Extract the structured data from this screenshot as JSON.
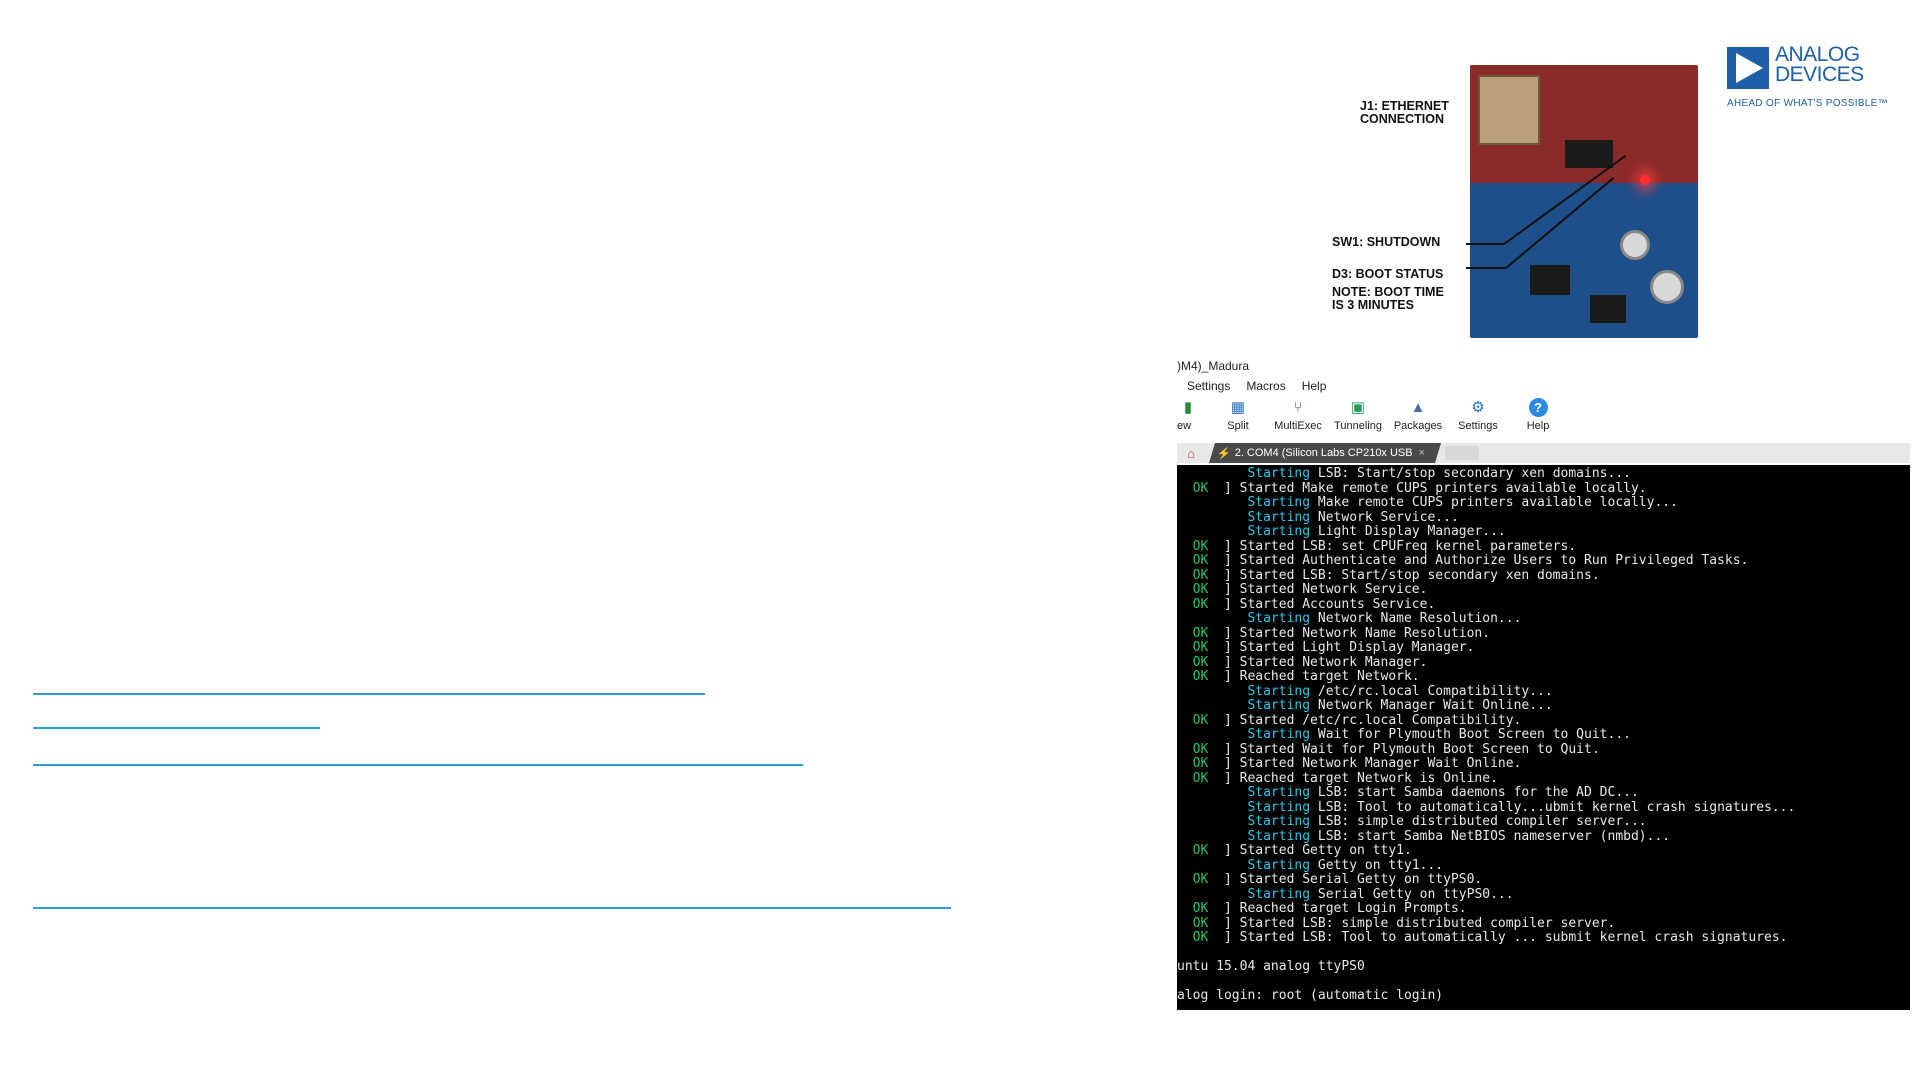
{
  "slide": {
    "link_count": 4
  },
  "board": {
    "callouts": {
      "ethernet": "J1: ETHERNET\nCONNECTION",
      "shutdown": "SW1: SHUTDOWN",
      "boot_status": "D3: BOOT STATUS",
      "boot_note": "NOTE: BOOT TIME\nIS 3 MINUTES"
    }
  },
  "logo": {
    "line1": "ANALOG",
    "line2": "DEVICES",
    "tagline": "AHEAD OF WHAT'S POSSIBLE™",
    "brand_color": "#1d5fa8"
  },
  "app": {
    "title": ")M4)_Madura",
    "menu": [
      "Settings",
      "Macros",
      "Help"
    ],
    "toolbar": [
      {
        "label": "ew",
        "icon": "session-icon"
      },
      {
        "label": "Split",
        "icon": "split-icon"
      },
      {
        "label": "MultiExec",
        "icon": "multiexec-icon"
      },
      {
        "label": "Tunneling",
        "icon": "tunneling-icon"
      },
      {
        "label": "Packages",
        "icon": "packages-icon"
      },
      {
        "label": "Settings",
        "icon": "settings-icon"
      },
      {
        "label": "Help",
        "icon": "help-icon"
      }
    ],
    "tab": {
      "label": "2. COM4  (Silicon Labs CP210x USB",
      "close": "×"
    },
    "terminal": {
      "lines": [
        {
          "kind": "starting",
          "text": "LSB: Start/stop secondary xen domains..."
        },
        {
          "kind": "ok",
          "text": "Started Make remote CUPS printers available locally."
        },
        {
          "kind": "starting",
          "text": "Make remote CUPS printers available locally..."
        },
        {
          "kind": "starting",
          "text": "Network Service..."
        },
        {
          "kind": "starting",
          "text": "Light Display Manager..."
        },
        {
          "kind": "ok",
          "text": "Started LSB: set CPUFreq kernel parameters."
        },
        {
          "kind": "ok",
          "text": "Started Authenticate and Authorize Users to Run Privileged Tasks."
        },
        {
          "kind": "ok",
          "text": "Started LSB: Start/stop secondary xen domains."
        },
        {
          "kind": "ok",
          "text": "Started Network Service."
        },
        {
          "kind": "ok",
          "text": "Started Accounts Service."
        },
        {
          "kind": "starting",
          "text": "Network Name Resolution..."
        },
        {
          "kind": "ok",
          "text": "Started Network Name Resolution."
        },
        {
          "kind": "ok",
          "text": "Started Light Display Manager."
        },
        {
          "kind": "ok",
          "text": "Started Network Manager."
        },
        {
          "kind": "ok",
          "text": "Reached target Network."
        },
        {
          "kind": "starting",
          "text": "/etc/rc.local Compatibility..."
        },
        {
          "kind": "starting",
          "text": "Network Manager Wait Online..."
        },
        {
          "kind": "ok",
          "text": "Started /etc/rc.local Compatibility."
        },
        {
          "kind": "starting",
          "text": "Wait for Plymouth Boot Screen to Quit..."
        },
        {
          "kind": "ok",
          "text": "Started Wait for Plymouth Boot Screen to Quit."
        },
        {
          "kind": "ok",
          "text": "Started Network Manager Wait Online."
        },
        {
          "kind": "ok",
          "text": "Reached target Network is Online."
        },
        {
          "kind": "starting",
          "text": "LSB: start Samba daemons for the AD DC..."
        },
        {
          "kind": "starting",
          "text": "LSB: Tool to automatically...ubmit kernel crash signatures..."
        },
        {
          "kind": "starting",
          "text": "LSB: simple distributed compiler server..."
        },
        {
          "kind": "starting",
          "text": "LSB: start Samba NetBIOS nameserver (nmbd)..."
        },
        {
          "kind": "ok",
          "text": "Started Getty on tty1."
        },
        {
          "kind": "starting",
          "text": "Getty on tty1..."
        },
        {
          "kind": "ok",
          "text": "Started Serial Getty on ttyPS0."
        },
        {
          "kind": "starting",
          "text": "Serial Getty on ttyPS0..."
        },
        {
          "kind": "ok",
          "text": "Reached target Login Prompts."
        },
        {
          "kind": "ok",
          "text": "Started LSB: simple distributed compiler server."
        },
        {
          "kind": "ok",
          "text": "Started LSB: Tool to automatically ... submit kernel crash signatures."
        },
        {
          "kind": "blank",
          "text": ""
        },
        {
          "kind": "plain",
          "text": "untu 15.04 analog ttyPS0"
        },
        {
          "kind": "blank",
          "text": ""
        },
        {
          "kind": "plain",
          "text": "alog login: root (automatic login)"
        }
      ],
      "ok_tag": "OK",
      "starting_tag": "Starting"
    }
  }
}
